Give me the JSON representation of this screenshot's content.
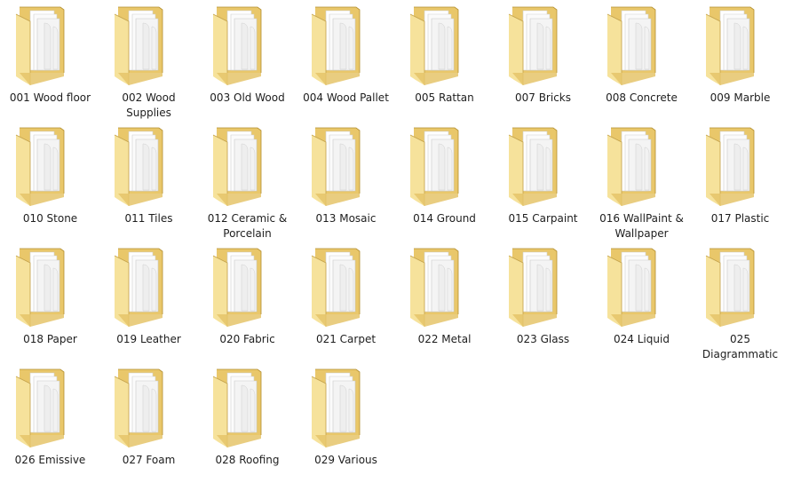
{
  "window": {
    "view": "large-icons"
  },
  "colors": {
    "folder_back": "#e9c76a",
    "folder_front": "#f6e29b",
    "paper": "#f7f7f7",
    "label_text": "#1e1e1e"
  },
  "folders": [
    {
      "label": "001 Wood floor",
      "icon": "folder-icon"
    },
    {
      "label": "002 Wood Supplies",
      "icon": "folder-icon"
    },
    {
      "label": "003 Old Wood",
      "icon": "folder-icon"
    },
    {
      "label": "004 Wood Pallet",
      "icon": "folder-icon"
    },
    {
      "label": "005 Rattan",
      "icon": "folder-icon"
    },
    {
      "label": "007 Bricks",
      "icon": "folder-icon"
    },
    {
      "label": "008 Concrete",
      "icon": "folder-icon"
    },
    {
      "label": "009 Marble",
      "icon": "folder-icon"
    },
    {
      "label": "010 Stone",
      "icon": "folder-icon"
    },
    {
      "label": "011 Tiles",
      "icon": "folder-icon"
    },
    {
      "label": "012 Ceramic & Porcelain",
      "icon": "folder-icon"
    },
    {
      "label": "013 Mosaic",
      "icon": "folder-icon"
    },
    {
      "label": "014 Ground",
      "icon": "folder-icon"
    },
    {
      "label": "015 Carpaint",
      "icon": "folder-icon"
    },
    {
      "label": "016 WallPaint & Wallpaper",
      "icon": "folder-icon"
    },
    {
      "label": "017 Plastic",
      "icon": "folder-icon"
    },
    {
      "label": "018 Paper",
      "icon": "folder-icon"
    },
    {
      "label": "019 Leather",
      "icon": "folder-icon"
    },
    {
      "label": "020 Fabric",
      "icon": "folder-icon"
    },
    {
      "label": "021 Carpet",
      "icon": "folder-icon"
    },
    {
      "label": "022 Metal",
      "icon": "folder-icon"
    },
    {
      "label": "023 Glass",
      "icon": "folder-icon"
    },
    {
      "label": "024 Liquid",
      "icon": "folder-icon"
    },
    {
      "label": "025 Diagrammatic",
      "icon": "folder-icon"
    },
    {
      "label": "026 Emissive",
      "icon": "folder-icon"
    },
    {
      "label": "027 Foam",
      "icon": "folder-icon"
    },
    {
      "label": "028 Roofing",
      "icon": "folder-icon"
    },
    {
      "label": "029 Various",
      "icon": "folder-icon"
    }
  ]
}
